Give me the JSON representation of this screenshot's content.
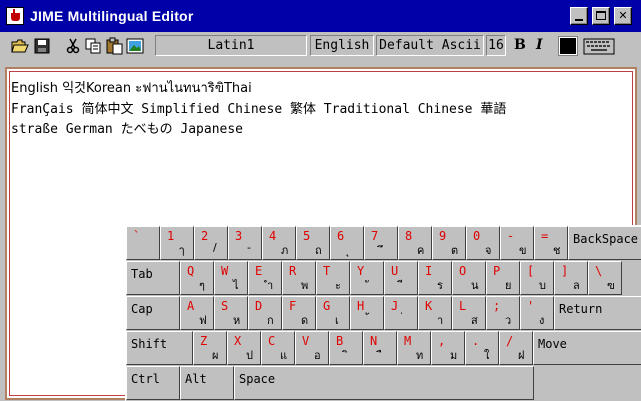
{
  "window": {
    "title": "JIME Multilingual Editor"
  },
  "toolbar": {
    "encoding": "Latin1",
    "language": "English",
    "font": "Default Ascii",
    "size": "16",
    "bold_label": "B",
    "italic_label": "I"
  },
  "editor": {
    "lines": [
      "English 익것Korean ะฟานไนทนาริฃิThai",
      "FranÇais 简体中文 Simplified Chinese 繁体 Traditional Chinese 華語",
      "straße German たべもの Japanese"
    ]
  },
  "keyboard": {
    "rows": [
      [
        {
          "lat": "`",
          "thai": ""
        },
        {
          "lat": "1",
          "thai": "ๅ"
        },
        {
          "lat": "2",
          "thai": "/"
        },
        {
          "lat": "3",
          "thai": "-"
        },
        {
          "lat": "4",
          "thai": "ภ"
        },
        {
          "lat": "5",
          "thai": "ถ"
        },
        {
          "lat": "6",
          "thai": "ุ"
        },
        {
          "lat": "7",
          "thai": "ึ"
        },
        {
          "lat": "8",
          "thai": "ค"
        },
        {
          "lat": "9",
          "thai": "ต"
        },
        {
          "lat": "0",
          "thai": "จ"
        },
        {
          "lat": "-",
          "thai": "ข"
        },
        {
          "lat": "=",
          "thai": "ช"
        },
        {
          "label": "BackSpace"
        }
      ],
      [
        {
          "label": "Tab"
        },
        {
          "lat": "Q",
          "thai": "ๆ"
        },
        {
          "lat": "W",
          "thai": "ไ"
        },
        {
          "lat": "E",
          "thai": "ำ"
        },
        {
          "lat": "R",
          "thai": "พ"
        },
        {
          "lat": "T",
          "thai": "ะ"
        },
        {
          "lat": "Y",
          "thai": "ั"
        },
        {
          "lat": "U",
          "thai": "ี"
        },
        {
          "lat": "I",
          "thai": "ร"
        },
        {
          "lat": "O",
          "thai": "น"
        },
        {
          "lat": "P",
          "thai": "ย"
        },
        {
          "lat": "[",
          "thai": "บ"
        },
        {
          "lat": "]",
          "thai": "ล"
        },
        {
          "lat": "\\",
          "thai": "ฃ"
        }
      ],
      [
        {
          "label": "Cap"
        },
        {
          "lat": "A",
          "thai": "ฟ"
        },
        {
          "lat": "S",
          "thai": "ห"
        },
        {
          "lat": "D",
          "thai": "ก"
        },
        {
          "lat": "F",
          "thai": "ด"
        },
        {
          "lat": "G",
          "thai": "เ"
        },
        {
          "lat": "H",
          "thai": "้"
        },
        {
          "lat": "J",
          "thai": "่"
        },
        {
          "lat": "K",
          "thai": "า"
        },
        {
          "lat": "L",
          "thai": "ส"
        },
        {
          "lat": ";",
          "thai": "ว"
        },
        {
          "lat": "'",
          "thai": "ง"
        },
        {
          "label": "Return"
        }
      ],
      [
        {
          "label": "Shift"
        },
        {
          "lat": "Z",
          "thai": "ผ"
        },
        {
          "lat": "X",
          "thai": "ป"
        },
        {
          "lat": "C",
          "thai": "แ"
        },
        {
          "lat": "V",
          "thai": "อ"
        },
        {
          "lat": "B",
          "thai": "ิ"
        },
        {
          "lat": "N",
          "thai": "ื"
        },
        {
          "lat": "M",
          "thai": "ท"
        },
        {
          "lat": ",",
          "thai": "ม"
        },
        {
          "lat": ".",
          "thai": "ใ"
        },
        {
          "lat": "/",
          "thai": "ฝ"
        },
        {
          "label": "Move"
        }
      ],
      [
        {
          "label": "Ctrl"
        },
        {
          "label": "Alt"
        },
        {
          "label": "Space"
        }
      ]
    ]
  }
}
